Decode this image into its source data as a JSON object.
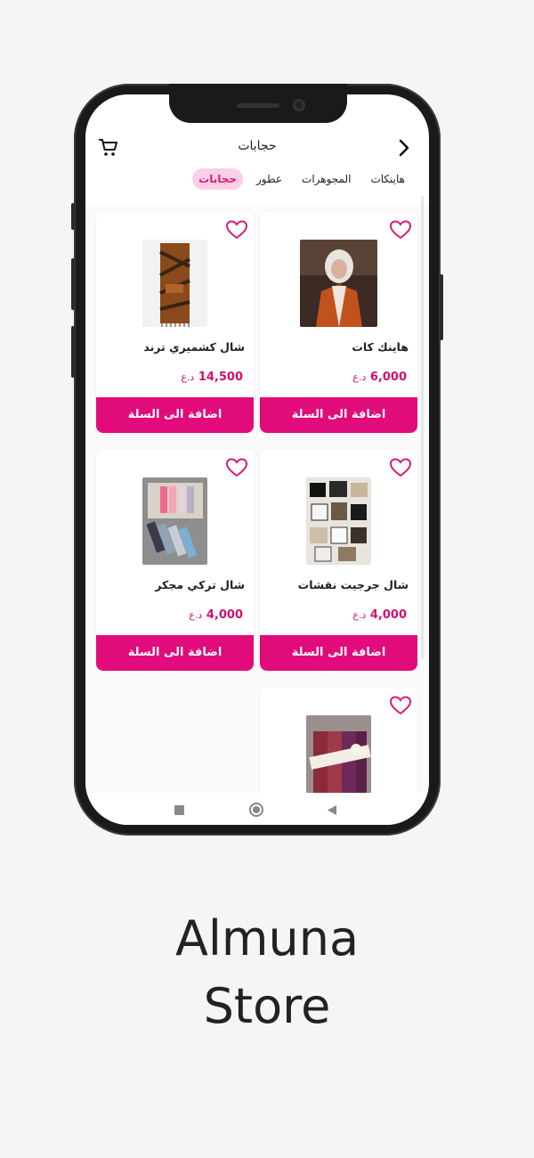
{
  "header": {
    "title": "حجابات"
  },
  "tabs": [
    {
      "label": "هاينكات",
      "active": false
    },
    {
      "label": "المجوهرات",
      "active": false
    },
    {
      "label": "عطور",
      "active": false
    },
    {
      "label": "حجابات",
      "active": true
    }
  ],
  "products": [
    {
      "name": "هاينك كات",
      "price": "6,000",
      "currency": "د.ع",
      "button": "اضافة الى السلة",
      "image": "woman-in-hijab-photo"
    },
    {
      "name": "شال كشميري ترند",
      "price": "14,500",
      "currency": "د.ع",
      "button": "اضافة الى السلة",
      "image": "brown-patterned-shawl-photo"
    },
    {
      "name": "شال جرجيت نقشات",
      "price": "4,000",
      "currency": "د.ع",
      "button": "اضافة الى السلة",
      "image": "folded-printed-scarves-photo"
    },
    {
      "name": "شال تركي مجكر",
      "price": "4,000",
      "currency": "د.ع",
      "button": "اضافة الى السلة",
      "image": "pastel-scarves-photo"
    },
    {
      "name": "",
      "price": "",
      "currency": "",
      "button": "",
      "image": "purple-scarves-gift-photo"
    }
  ],
  "icons": {
    "cart": "cart-icon",
    "back": "chevron-right-icon",
    "favorite": "heart-outline-icon",
    "nav_recent": "square-icon",
    "nav_home": "circle-icon",
    "nav_back": "triangle-icon"
  },
  "colors": {
    "accent": "#e20b7b",
    "tab_active_bg": "#fbd0e6",
    "price": "#d0106e"
  },
  "caption": {
    "line1": "Almuna",
    "line2": "Store"
  }
}
